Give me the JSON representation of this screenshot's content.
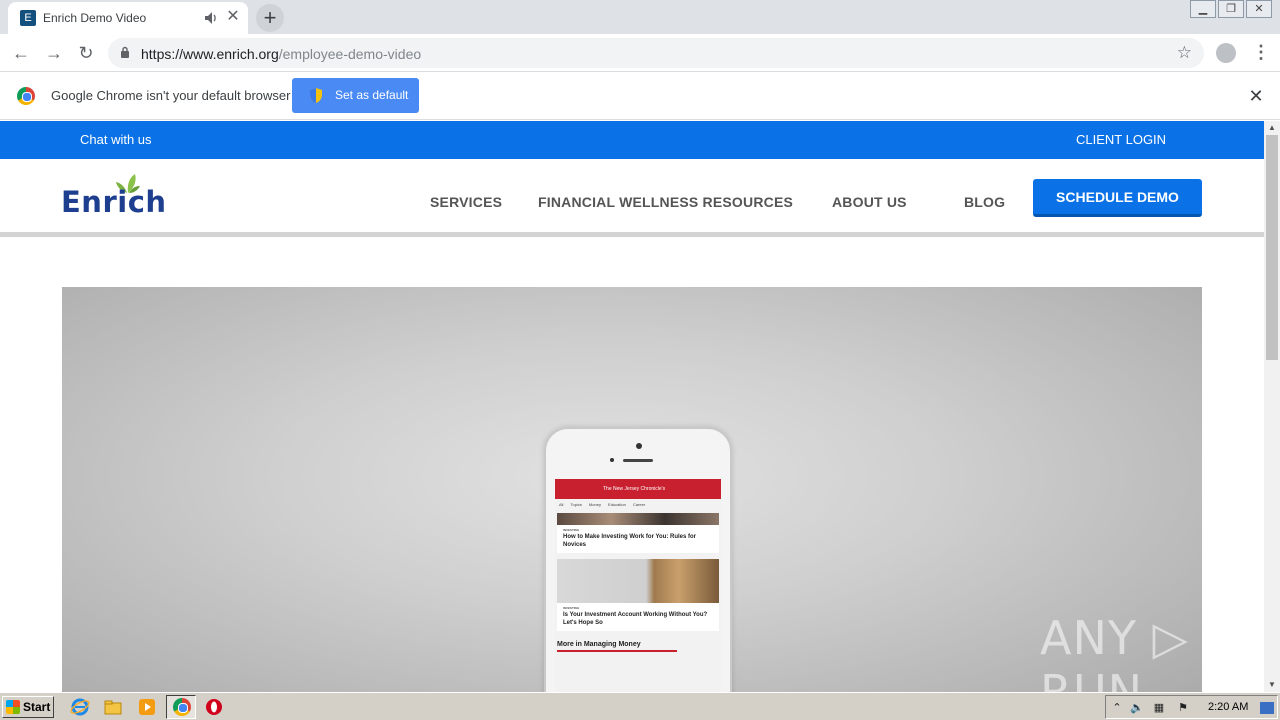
{
  "browser": {
    "tab_title": "Enrich Demo Video",
    "url_host": "https://www.enrich.org",
    "url_path": "/employee-demo-video",
    "new_tab": "+",
    "tab_close": "✕"
  },
  "infobar": {
    "message": "Google Chrome isn't your default browser",
    "button": "Set as default",
    "close": "✕"
  },
  "site": {
    "topbar": {
      "chat": "Chat with us",
      "login": "CLIENT LOGIN"
    },
    "logo": "Enrich",
    "nav": [
      {
        "label": "SERVICES"
      },
      {
        "label": "FINANCIAL WELLNESS RESOURCES"
      },
      {
        "label": "ABOUT US"
      },
      {
        "label": "BLOG"
      }
    ],
    "cta": "SCHEDULE DEMO"
  },
  "video": {
    "phone_app_header": "The New Jersey Chronicle's",
    "phone_tabs": "All Topics Money Education Career",
    "cards": [
      {
        "category": "INVESTING",
        "title": "How to Make Investing Work for You: Rules for Novices"
      },
      {
        "category": "INVESTING",
        "title": "Is Your Investment Account Working Without You? Let's Hope So"
      }
    ],
    "section": "More in Managing Money",
    "watermark": "ANY ▷ RUN"
  },
  "taskbar": {
    "start": "Start",
    "clock": "2:20 AM"
  }
}
